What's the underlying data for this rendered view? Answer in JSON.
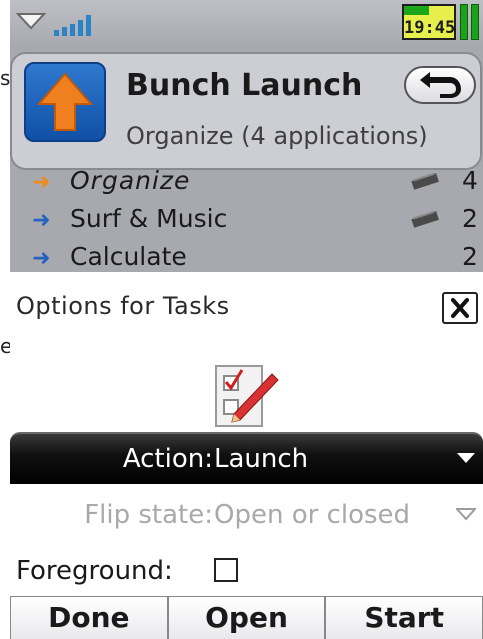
{
  "edge_glyphs": {
    "top": "s",
    "middle": "e"
  },
  "status_bar": {
    "time": "19:45",
    "signal_bars": 5,
    "battery_level": 0.5,
    "colors": {
      "signal": "#2a84c8",
      "battery_ok": "#1aa81a",
      "clock_bg": "#e7ef4d"
    },
    "icons": [
      "status-arrow-icon",
      "signal-strength-icon",
      "battery-icon",
      "battery-bars-icon"
    ]
  },
  "app_header": {
    "title": "Bunch Launch",
    "subtitle": "Organize (4 applications)",
    "icon": "orange-up-arrow-icon",
    "back_icon": "back-arrow-icon"
  },
  "task_list": [
    {
      "name": "Organize",
      "count": "4",
      "selected": true,
      "bullet_color": "#ee8a1c"
    },
    {
      "name": "Surf & Music",
      "count": "2",
      "selected": false,
      "bullet_color": "#2462c0"
    },
    {
      "name": "Calculate",
      "count": "2",
      "selected": false,
      "bullet_color": "#2462c0"
    }
  ],
  "dialog": {
    "title": "Options for Tasks",
    "close_icon": "close-x-icon",
    "task_icon": "checklist-pencil-icon",
    "fields": {
      "action": {
        "label": "Action:",
        "value": "Launch",
        "state": "focused"
      },
      "flip_state": {
        "label": "Flip state:",
        "value": "Open or closed",
        "state": "disabled"
      },
      "foreground": {
        "label": "Foreground:",
        "checked": false
      }
    }
  },
  "softkeys": {
    "left": "Done",
    "middle": "Open",
    "right": "Start"
  }
}
